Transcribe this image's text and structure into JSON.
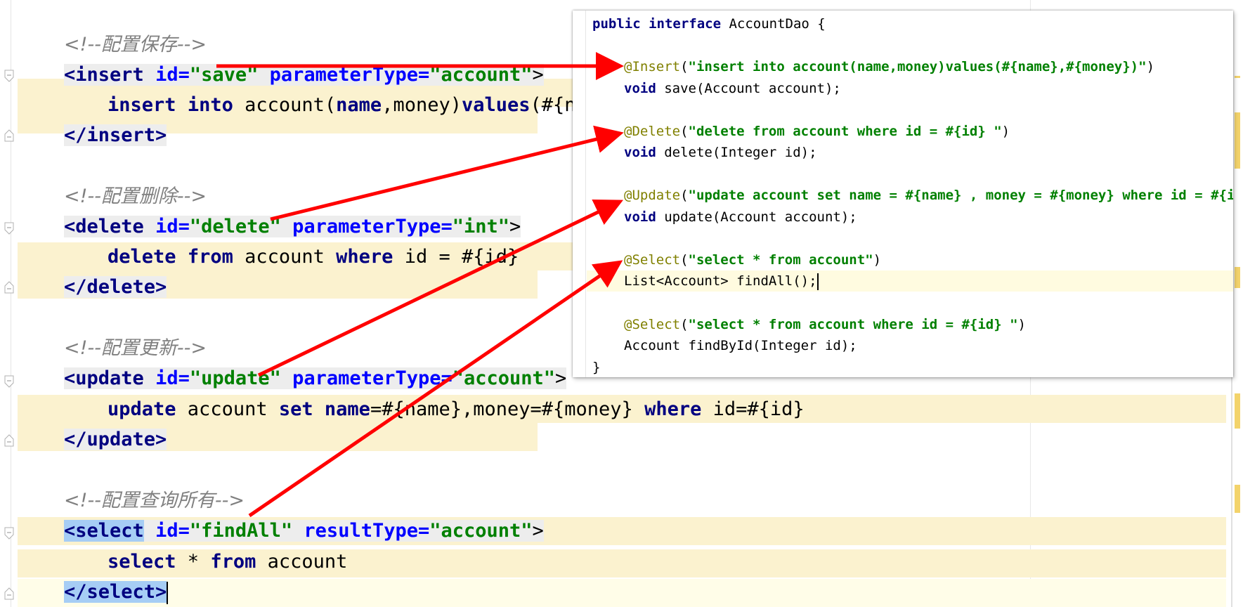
{
  "xml_editor": {
    "comment_save": "<!--配置保存-->",
    "insert_open": {
      "tag": "<insert",
      "attr1": "id=",
      "val1": "\"save\"",
      "attr2": "parameterType=",
      "val2": "\"account\"",
      "close": ">"
    },
    "insert_body": {
      "k1": "insert",
      "k2": "into",
      "t1": " account(",
      "k3": "name",
      "t2": ",money)",
      "k4": "values",
      "t3": "(#{na"
    },
    "insert_close": "</insert>",
    "comment_delete": "<!--配置删除-->",
    "delete_open": {
      "tag": "<delete",
      "attr1": "id=",
      "val1": "\"delete\"",
      "attr2": "parameterType=",
      "val2": "\"int\"",
      "close": ">"
    },
    "delete_body": {
      "k1": "delete",
      "k2": "from",
      "t1": " account ",
      "k3": "where",
      "t2": " id = #{id}"
    },
    "delete_close": "</delete>",
    "comment_update": "<!--配置更新-->",
    "update_open": {
      "tag": "<update",
      "attr1": "id=",
      "val1": "\"update\"",
      "attr2": "parameterType=",
      "val2": "\"account\"",
      "close": ">"
    },
    "update_body": {
      "k1": "update",
      "t1": " account ",
      "k2": "set",
      "k3": "name",
      "t2": "=#{name},money=#{money} ",
      "k4": "where",
      "t3": " id=#{id}"
    },
    "update_close": "</update>",
    "comment_findall": "<!--配置查询所有-->",
    "select_open": {
      "tag": "<select",
      "attr1": "id=",
      "val1": "\"findAll\"",
      "attr2": "resultType=",
      "val2": "\"account\"",
      "close": ">"
    },
    "select_body": {
      "k1": "select",
      "t1": " * ",
      "k2": "from",
      "t2": " account"
    },
    "select_close": "</select>"
  },
  "java_popup": {
    "l1": {
      "kw": "public interface",
      "rest": " AccountDao {"
    },
    "l3": {
      "ann": "@Insert",
      "p1": "(",
      "str": "\"insert into account(name,money)values(#{name},#{money})\"",
      "p2": ")"
    },
    "l4": {
      "kw": "void",
      "rest": " save(Account account);"
    },
    "l6": {
      "ann": "@Delete",
      "p1": "(",
      "str": "\"delete from account where id = #{id} \"",
      "p2": ")"
    },
    "l7": {
      "kw": "void",
      "rest": " delete(Integer id);"
    },
    "l9": {
      "ann": "@Update",
      "p1": "(",
      "str": "\"update account set name = #{name} , money = #{money} where id = #{id"
    },
    "l10": {
      "kw": "void",
      "rest": " update(Account account);"
    },
    "l12": {
      "ann": "@Select",
      "p1": "(",
      "str": "\"select * from account\"",
      "p2": ")"
    },
    "l13": {
      "rest": "List<Account> findAll();"
    },
    "l15": {
      "ann": "@Select",
      "p1": "(",
      "str": "\"select * from account where id = #{id} \"",
      "p2": ")"
    },
    "l16": {
      "rest": "Account findById(Integer id);"
    },
    "l17": {
      "rest": "}"
    }
  },
  "colors": {
    "arrow": "#ff0000",
    "highlight_band": "#fbf2cf",
    "selection": "#a6cdf5",
    "keyword": "#000080",
    "string": "#008000",
    "annotation": "#808000"
  }
}
